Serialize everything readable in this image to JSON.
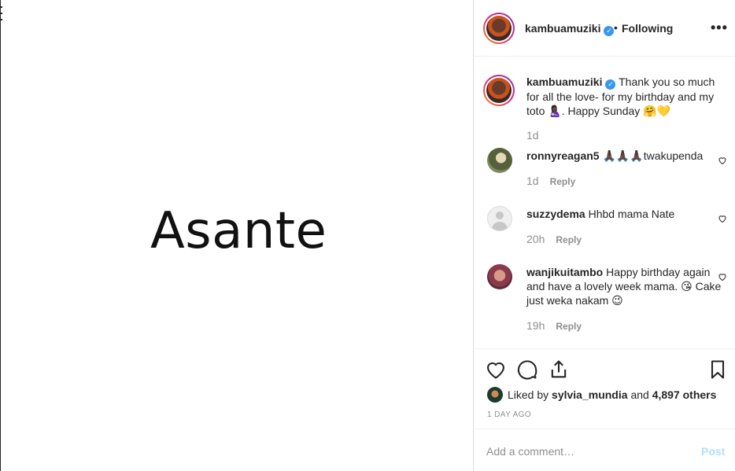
{
  "media": {
    "text": "Asante"
  },
  "header": {
    "username": "kambuamuziki",
    "separator": "•",
    "follow_status": "Following",
    "more_label": "•••"
  },
  "caption": {
    "username": "kambuamuziki",
    "text": "Thank you so much for all the love- for my birthday and my toto 🤱🏿. Happy Sunday 🤗💛",
    "time": "1d"
  },
  "comments": [
    {
      "username": "ronnyreagan5",
      "text": "🙏🏿🙏🏿🙏🏿twakupenda",
      "time": "1d",
      "reply": "Reply"
    },
    {
      "username": "suzzydema",
      "text": "Hhbd mama Nate",
      "time": "20h",
      "reply": "Reply"
    },
    {
      "username": "wanjikuitambo",
      "text": "Happy birthday again and have a lovely week mama. 😘 Cake just weka nakam 😉",
      "time": "19h",
      "reply": "Reply"
    }
  ],
  "likes": {
    "prefix": "Liked by",
    "user": "sylvia_mundia",
    "joiner": "and",
    "others": "4,897 others"
  },
  "timestamp": "1 DAY AGO",
  "add_comment": {
    "placeholder": "Add a comment…",
    "post_label": "Post"
  },
  "colors": {
    "verified": "#3897f0",
    "muted": "#8e8e8e",
    "post_disabled": "#b2dffc"
  }
}
